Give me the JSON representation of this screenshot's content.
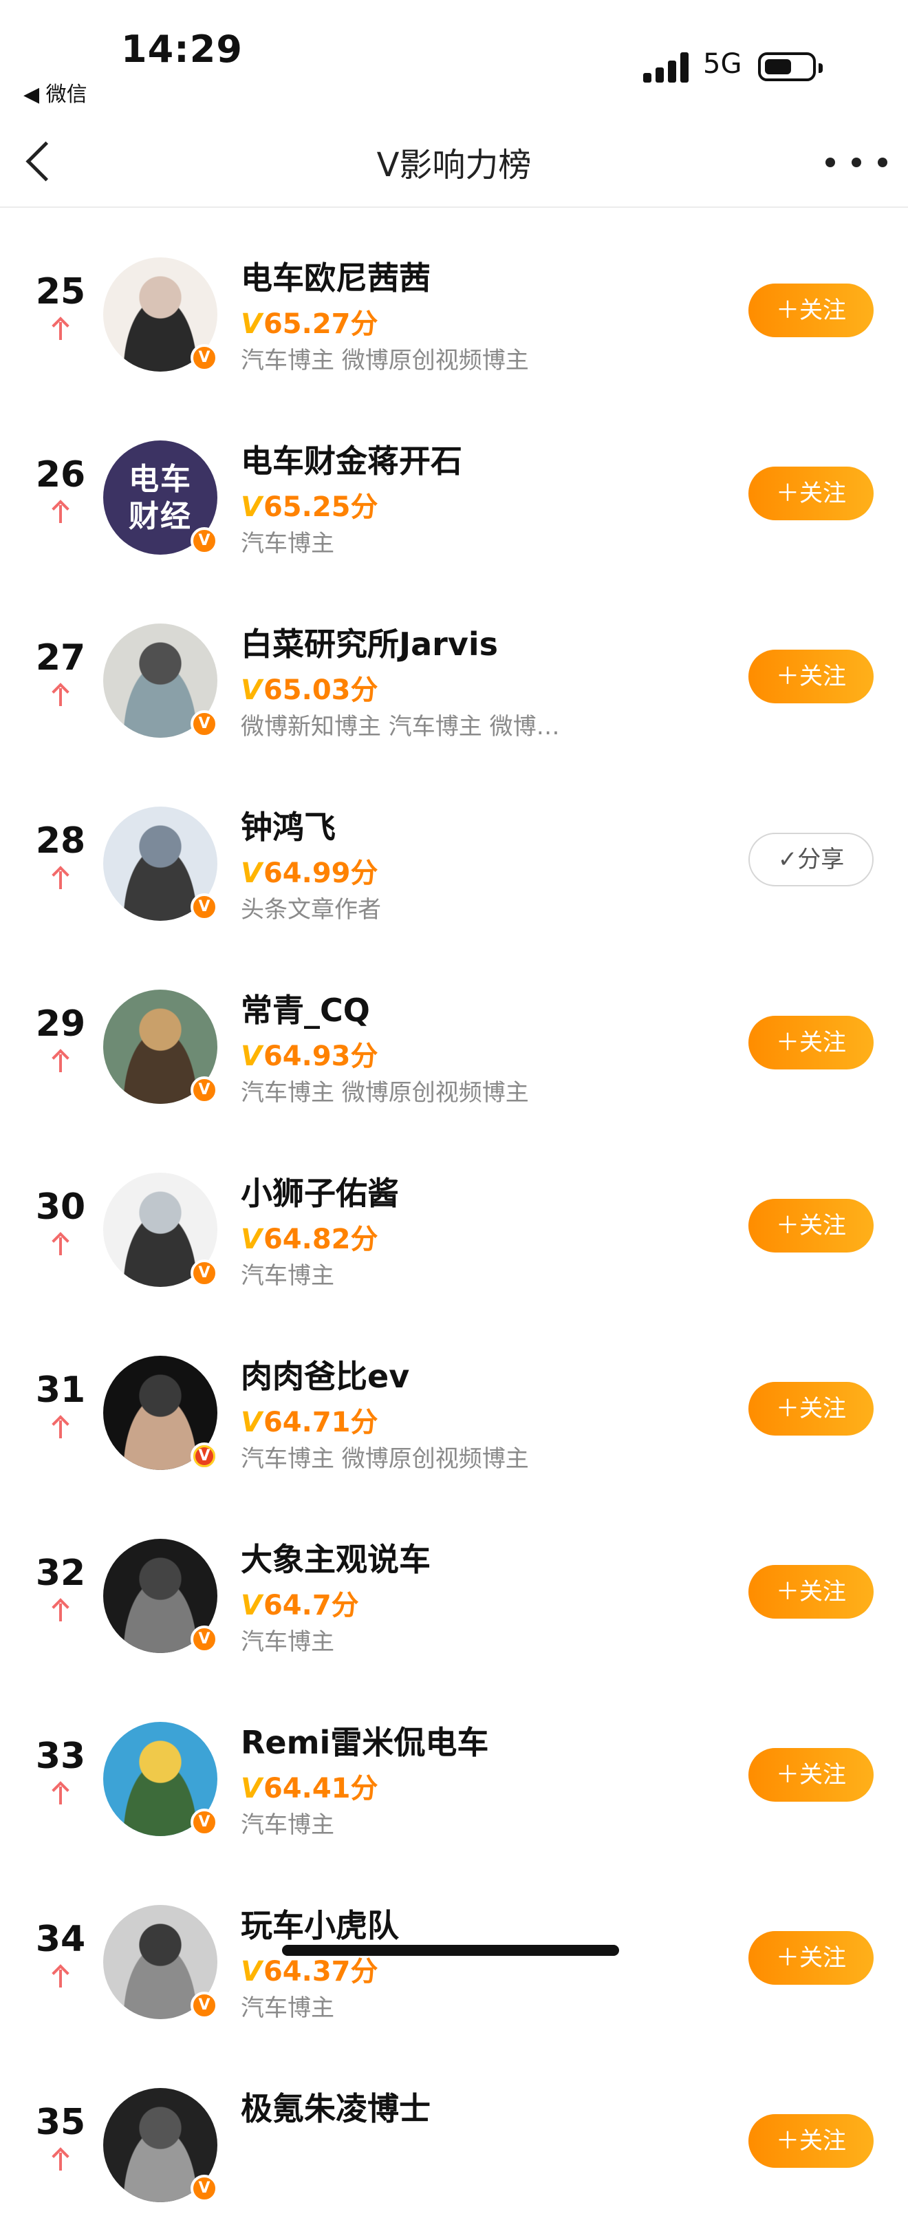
{
  "status_bar": {
    "time": "14:29",
    "back_app": "◀ 微信",
    "network": "5G"
  },
  "nav": {
    "title": "V影响力榜"
  },
  "rows": [
    {
      "rank": "25",
      "name": "电车欧尼茜茜",
      "score": "65.27分",
      "tags": "汽车博主 微博原创视频博主",
      "button": "＋关注",
      "followed": false,
      "avatar_colors": [
        "#f3eee9",
        "#d9c3b6",
        "#2a2a2a"
      ]
    },
    {
      "rank": "26",
      "name": "电车财金蒋开石",
      "score": "65.25分",
      "tags": "汽车博主",
      "button": "＋关注",
      "followed": false,
      "avatar_colors": [
        "#3c3363",
        "#ffffff",
        "#ff3b3b"
      ],
      "avatar_text": "电车财经"
    },
    {
      "rank": "27",
      "name": "白菜研究所Jarvis",
      "score": "65.03分",
      "tags": "微博新知博主 汽车博主 微博…",
      "button": "＋关注",
      "followed": false,
      "avatar_colors": [
        "#d9d9d4",
        "#505050",
        "#8aa0a8"
      ]
    },
    {
      "rank": "28",
      "name": "钟鸿飞",
      "score": "64.99分",
      "tags": "头条文章作者",
      "button": "分享",
      "followed": true,
      "avatar_colors": [
        "#dfe6ee",
        "#7c8a9a",
        "#3a3a3a"
      ]
    },
    {
      "rank": "29",
      "name": "常青_CQ",
      "score": "64.93分",
      "tags": "汽车博主 微博原创视频博主",
      "button": "＋关注",
      "followed": false,
      "avatar_colors": [
        "#6e8b74",
        "#c9a06a",
        "#4c3a2a"
      ]
    },
    {
      "rank": "30",
      "name": "小狮子佑酱",
      "score": "64.82分",
      "tags": "汽车博主",
      "button": "＋关注",
      "followed": false,
      "avatar_colors": [
        "#f2f2f2",
        "#bfc6cc",
        "#333333"
      ]
    },
    {
      "rank": "31",
      "name": "肉肉爸比ev",
      "score": "64.71分",
      "tags": "汽车博主 微博原创视频博主",
      "button": "＋关注",
      "followed": false,
      "avatar_colors": [
        "#111111",
        "#3a3a3a",
        "#c9a58b"
      ],
      "badge": "gold"
    },
    {
      "rank": "32",
      "name": "大象主观说车",
      "score": "64.7分",
      "tags": "汽车博主",
      "button": "＋关注",
      "followed": false,
      "avatar_colors": [
        "#1a1a1a",
        "#444444",
        "#7a7a7a"
      ]
    },
    {
      "rank": "33",
      "name": "Remi雷米侃电车",
      "score": "64.41分",
      "tags": "汽车博主",
      "button": "＋关注",
      "followed": false,
      "avatar_colors": [
        "#3da3d6",
        "#f0c94a",
        "#3d6b3a"
      ]
    },
    {
      "rank": "34",
      "name": "玩车小虎队",
      "score": "64.37分",
      "tags": "汽车博主",
      "button": "＋关注",
      "followed": false,
      "avatar_colors": [
        "#cfcfcf",
        "#3a3a3a",
        "#8c8c8c"
      ]
    },
    {
      "rank": "35",
      "name": "极氪朱凌博士",
      "score": "",
      "tags": "",
      "button": "＋关注",
      "followed": false,
      "avatar_colors": [
        "#222222",
        "#555555",
        "#999999"
      ]
    }
  ],
  "score_prefix": "V",
  "badge_letter": "V"
}
